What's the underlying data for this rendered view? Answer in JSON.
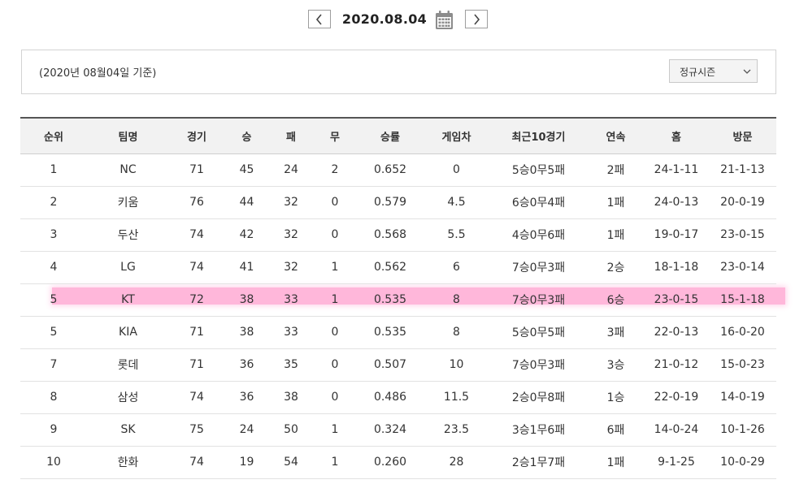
{
  "date_nav": {
    "date": "2020.08.04",
    "prev_icon": "chevron-left-icon",
    "next_icon": "chevron-right-icon",
    "calendar_icon": "calendar-icon"
  },
  "filter": {
    "caption": "(2020년 08월04일 기준)",
    "season": "정규시즌"
  },
  "table": {
    "headers": [
      "순위",
      "팀명",
      "경기",
      "승",
      "패",
      "무",
      "승률",
      "게임차",
      "최근10경기",
      "연속",
      "홈",
      "방문"
    ],
    "rows": [
      [
        "1",
        "NC",
        "71",
        "45",
        "24",
        "2",
        "0.652",
        "0",
        "5승0무5패",
        "2패",
        "24-1-11",
        "21-1-13"
      ],
      [
        "2",
        "키움",
        "76",
        "44",
        "32",
        "0",
        "0.579",
        "4.5",
        "6승0무4패",
        "1패",
        "24-0-13",
        "20-0-19"
      ],
      [
        "3",
        "두산",
        "74",
        "42",
        "32",
        "0",
        "0.568",
        "5.5",
        "4승0무6패",
        "1패",
        "19-0-17",
        "23-0-15"
      ],
      [
        "4",
        "LG",
        "74",
        "41",
        "32",
        "1",
        "0.562",
        "6",
        "7승0무3패",
        "2승",
        "18-1-18",
        "23-0-14"
      ],
      [
        "5",
        "KT",
        "72",
        "38",
        "33",
        "1",
        "0.535",
        "8",
        "7승0무3패",
        "6승",
        "23-0-15",
        "15-1-18"
      ],
      [
        "5",
        "KIA",
        "71",
        "38",
        "33",
        "0",
        "0.535",
        "8",
        "5승0무5패",
        "3패",
        "22-0-13",
        "16-0-20"
      ],
      [
        "7",
        "롯데",
        "71",
        "36",
        "35",
        "0",
        "0.507",
        "10",
        "7승0무3패",
        "3승",
        "21-0-12",
        "15-0-23"
      ],
      [
        "8",
        "삼성",
        "74",
        "36",
        "38",
        "0",
        "0.486",
        "11.5",
        "2승0무8패",
        "1승",
        "22-0-19",
        "14-0-19"
      ],
      [
        "9",
        "SK",
        "75",
        "24",
        "50",
        "1",
        "0.324",
        "23.5",
        "3승1무6패",
        "6패",
        "14-0-24",
        "10-1-26"
      ],
      [
        "10",
        "한화",
        "74",
        "19",
        "54",
        "1",
        "0.260",
        "28",
        "2승1무7패",
        "1패",
        "9-1-25",
        "10-0-29"
      ]
    ],
    "highlight_row": 4,
    "highlight_color": "#ff9fce"
  }
}
